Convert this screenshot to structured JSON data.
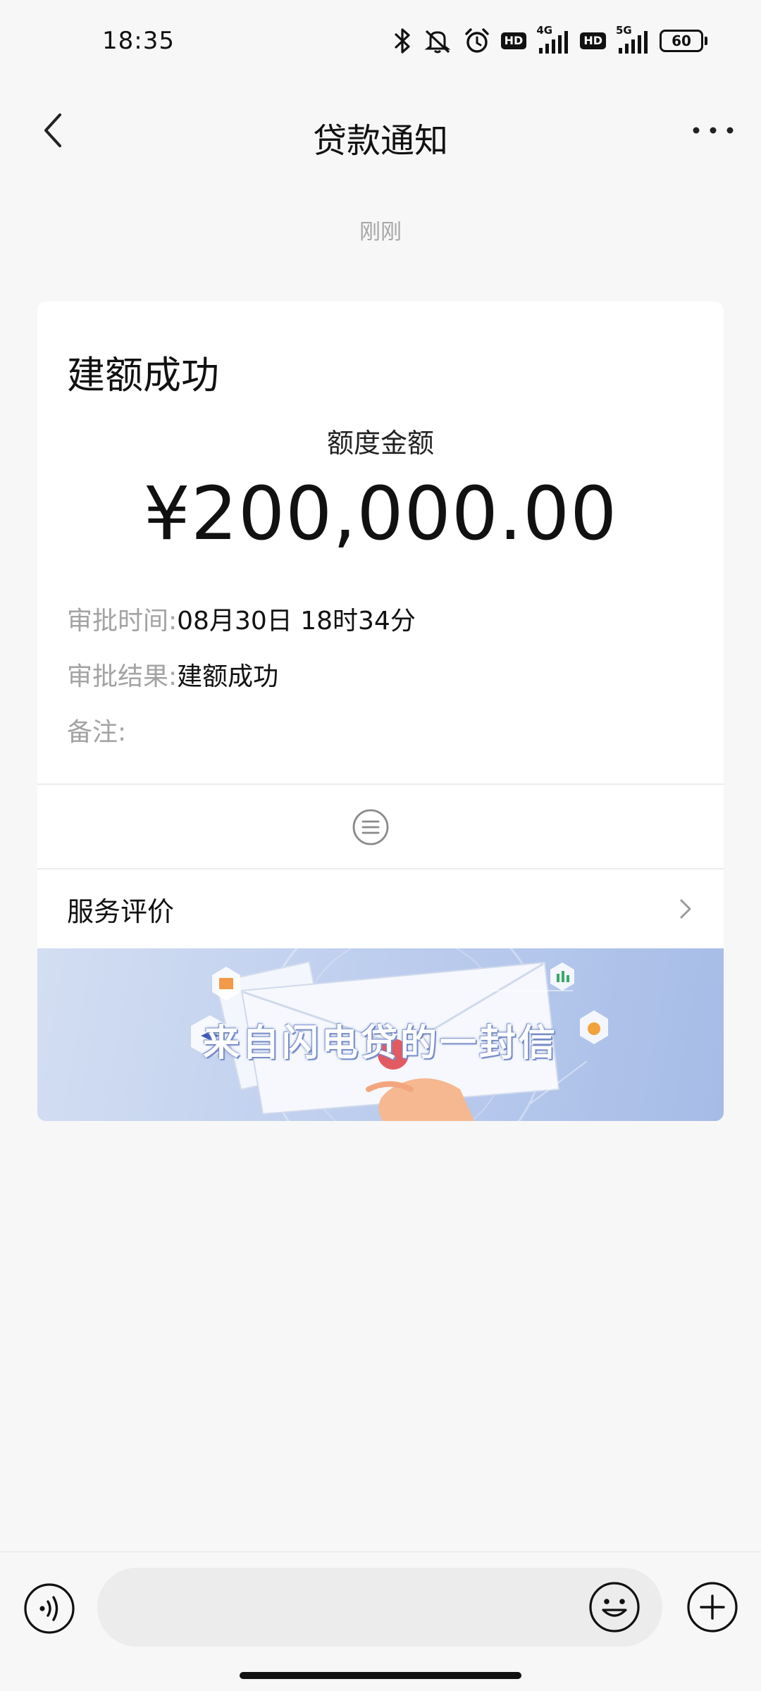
{
  "status_bar": {
    "time": "18:35",
    "net1_label": "4G",
    "net2_label": "5G",
    "hd_label": "HD",
    "battery": "60",
    "icons": [
      "bluetooth-icon",
      "mute-vibrate-icon",
      "alarm-icon",
      "signal-icon",
      "battery-icon"
    ]
  },
  "nav": {
    "title": "贷款通知",
    "back_icon": "chevron-left-icon",
    "more_icon": "more-dots-icon"
  },
  "message": {
    "timestamp": "刚刚"
  },
  "card": {
    "title": "建额成功",
    "amount_label": "额度金额",
    "amount": "¥200,000.00",
    "details": [
      {
        "label": "审批时间:",
        "value": "08月30日 18时34分"
      },
      {
        "label": "审批结果:",
        "value": "建额成功"
      },
      {
        "label": "备注:",
        "value": ""
      }
    ],
    "menu_icon": "list-menu-icon",
    "service_label": "服务评价",
    "banner_text": "来自闪电贷的一封信"
  },
  "input_bar": {
    "input_value": "",
    "voice_icon": "voice-icon",
    "emoji_icon": "emoji-icon",
    "plus_icon": "plus-icon"
  },
  "colors": {
    "background": "#f7f7f7",
    "card": "#ffffff",
    "muted_text": "#a3a3a3",
    "banner": "#b6c8ec"
  }
}
